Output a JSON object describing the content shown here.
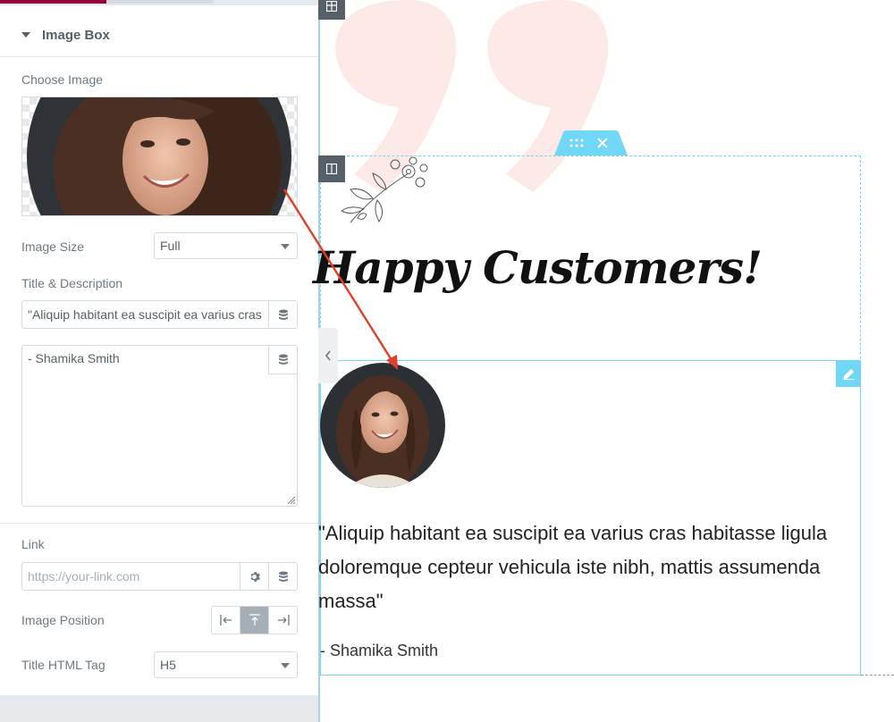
{
  "panel": {
    "section_title": "Image Box",
    "choose_image_label": "Choose Image",
    "image_size": {
      "label": "Image Size",
      "value": "Full"
    },
    "title_description_label": "Title & Description",
    "title_value": "\"Aliquip habitant ea suscipit ea varius cras habitasse",
    "description_value": "- Shamika Smith",
    "link": {
      "label": "Link",
      "placeholder": "https://your-link.com"
    },
    "image_position": {
      "label": "Image Position",
      "options": [
        "left",
        "top",
        "right"
      ],
      "selected": "top"
    },
    "title_html_tag": {
      "label": "Title HTML Tag",
      "value": "H5"
    }
  },
  "canvas": {
    "heading": "Happy Customers!",
    "quote": "\"Aliquip habitant ea suscipit ea varius cras habitasse ligula doloremque cepteur vehicula iste nibh, mattis assumenda massa\"",
    "author": "- Shamika Smith"
  },
  "colors": {
    "accent": "#93003c",
    "editor_blue": "#71d7f7",
    "annotation_arrow": "#e0402a",
    "quote_mark": "#fde9e6"
  }
}
